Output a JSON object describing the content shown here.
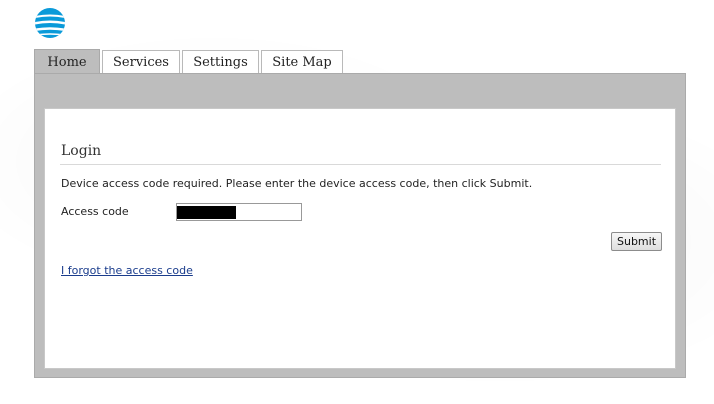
{
  "brand": {
    "logo_icon": "att-globe-icon",
    "accent": "#0a9ad9"
  },
  "tabs": [
    {
      "label": "Home",
      "active": true
    },
    {
      "label": "Services",
      "active": false
    },
    {
      "label": "Settings",
      "active": false
    },
    {
      "label": "Site Map",
      "active": false
    }
  ],
  "login": {
    "title": "Login",
    "instructions": "Device access code required. Please enter the device access code, then click Submit.",
    "access_code_label": "Access code",
    "access_code_value": "",
    "submit_label": "Submit",
    "forgot_link": "I forgot the access code"
  },
  "colors": {
    "frame_bg": "#bdbdbd",
    "link": "#1a3c8c"
  }
}
